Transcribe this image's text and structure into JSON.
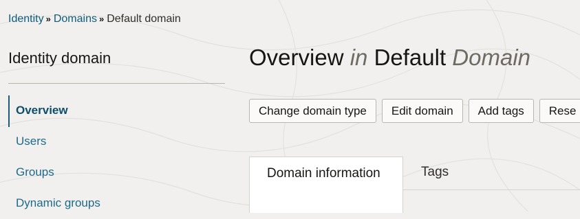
{
  "breadcrumb": {
    "items": [
      "Identity",
      "Domains"
    ],
    "separator": "»",
    "current": "Default domain"
  },
  "sidebar": {
    "title": "Identity domain",
    "items": [
      {
        "label": "Overview",
        "active": true
      },
      {
        "label": "Users"
      },
      {
        "label": "Groups"
      },
      {
        "label": "Dynamic groups"
      }
    ]
  },
  "header": {
    "title_part1": "Overview",
    "title_in": "in",
    "title_part2": "Default",
    "title_part3": "Domain"
  },
  "actions": {
    "change_domain_type": "Change domain type",
    "edit_domain": "Edit domain",
    "add_tags": "Add tags",
    "reset": "Rese"
  },
  "tabs": {
    "domain_information": "Domain information",
    "tags": "Tags"
  },
  "colors": {
    "link": "#0f5c7a",
    "background": "#f1f0ee",
    "active_indicator": "#1d5c78"
  }
}
